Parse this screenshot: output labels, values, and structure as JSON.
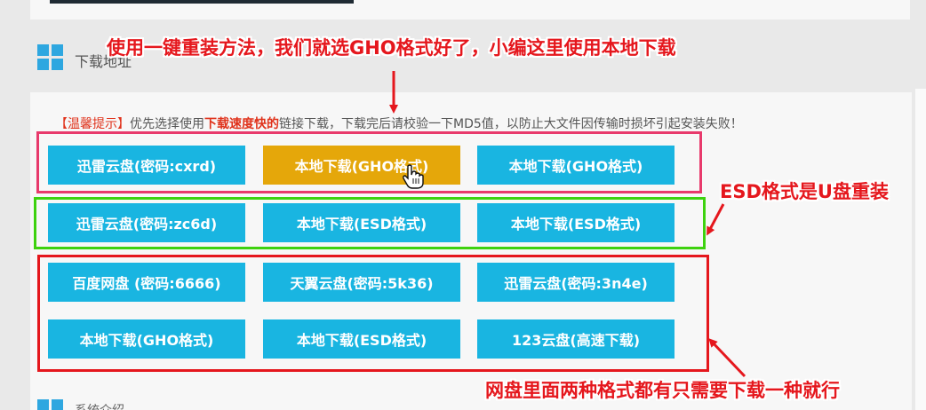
{
  "section": {
    "title": "下载地址"
  },
  "notice": {
    "tag": "【温馨提示】",
    "part1": "优先选择使用",
    "highlight": "下载速度快的",
    "part2": "链接下载，下载完后请校验一下MD5值，以防止大文件因传输时损坏引起安装失败！"
  },
  "rows": [
    [
      "迅雷云盘(密码:cxrd)",
      "本地下载(GHO格式)",
      "本地下载(GHO格式)"
    ],
    [
      "迅雷云盘(密码:zc6d)",
      "本地下载(ESD格式)",
      "本地下载(ESD格式)"
    ],
    [
      "百度网盘 (密码:6666)",
      "天翼云盘(密码:5k36)",
      "迅雷云盘(密码:3n4e)"
    ],
    [
      "本地下载(GHO格式)",
      "本地下载(ESD格式)",
      "123云盘(高速下载)"
    ]
  ],
  "annotations": {
    "top": "使用一键重装方法，我们就选GHO格式好了，小编这里使用本地下载",
    "esd": "ESD格式是U盘重装",
    "bottom": "网盘里面两种格式都有只需要下载一种就行"
  },
  "next_section": {
    "title": "系统介绍"
  },
  "colors": {
    "button": "#19b5e1",
    "button_hover": "#e5a70a",
    "accent_red": "#e5171d",
    "box_pink": "#e83a6c",
    "box_green": "#3ed20f",
    "logo_blue": "#2ea7e0"
  },
  "icons": [
    "section-logo-icon",
    "arrow-icon",
    "pointer-cursor-icon"
  ]
}
